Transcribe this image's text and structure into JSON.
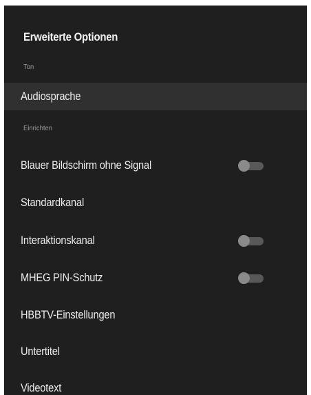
{
  "panel": {
    "title": "Erweiterte Optionen"
  },
  "sections": {
    "ton": "Ton",
    "einrichten": "Einrichten"
  },
  "items": {
    "audiosprache": {
      "label": "Audiosprache"
    },
    "blauer_bildschirm": {
      "label": "Blauer Bildschirm ohne Signal",
      "toggle": "off"
    },
    "standardkanal": {
      "label": "Standardkanal"
    },
    "interaktionskanal": {
      "label": "Interaktionskanal",
      "toggle": "off"
    },
    "mheg_pin": {
      "label": "MHEG PIN-Schutz",
      "toggle": "off"
    },
    "hbbtv": {
      "label": "HBBTV-Einstellungen"
    },
    "untertitel": {
      "label": "Untertitel"
    },
    "videotext": {
      "label": "Videotext"
    }
  },
  "colors": {
    "panel_background": "#1f1f1f",
    "focus_highlight": "#303030",
    "toggle_track": "#585858",
    "toggle_thumb": "#8a8a8a"
  }
}
